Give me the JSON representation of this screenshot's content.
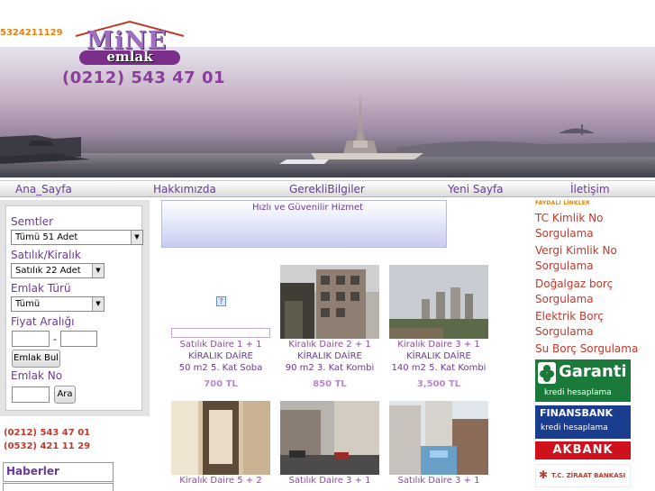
{
  "header": {
    "top_phone": "5324211129",
    "logo_line1": "MiNE",
    "logo_line2": "emlak",
    "phone": "(0212) 543 47 01"
  },
  "nav": [
    "Ana_Sayfa",
    "Hakkımızda",
    "GerekliBilgiler",
    "Yeni Sayfa",
    "İletişim"
  ],
  "search": {
    "semtler_label": "Semtler",
    "semtler_value": "Tümü    51   Adet",
    "satilik_label": "Satılık/Kiralık",
    "satilik_value": "Satılık    22  Adet",
    "emlak_turu_label": "Emlak Türü",
    "emlak_turu_value": "Tümü",
    "fiyat_label": "Fiyat Aralığı",
    "fiyat_dash": "-",
    "emlak_bul": "Emlak Bul",
    "emlak_no_label": "Emlak No",
    "ara": "Ara"
  },
  "contacts": [
    "(0212) 543 47 01",
    "(0532) 421 11 29"
  ],
  "haberler": "Haberler",
  "slogan": "Hızlı ve Güvenilir Hizmet",
  "listings": [
    {
      "line1": "Satılık  Daire 1 + 1",
      "line2": "KİRALIK DAİRE",
      "line3": "50 m2 5. Kat Soba",
      "price": "700 TL"
    },
    {
      "line1": "Kiralık  Daire 2 + 1",
      "line2": "KİRALIK DAİRE",
      "line3": "90 m2 3. Kat Kombi",
      "price": "850 TL"
    },
    {
      "line1": "Kiralık  Daire 3 + 1",
      "line2": "KİRALIK DAİRE",
      "line3": "140 m2 5. Kat Kombi",
      "price": "3,500 TL"
    },
    {
      "line1": "Kiralık  Daire 5 + 2",
      "line2": "",
      "line3": "",
      "price": ""
    },
    {
      "line1": "Satılık  Daire 3 + 1",
      "line2": "",
      "line3": "",
      "price": ""
    },
    {
      "line1": "Satılık  Daire 3 + 1",
      "line2": "",
      "line3": "",
      "price": ""
    }
  ],
  "links": {
    "title": "FAYDALI LİNKLER",
    "items": [
      "TC Kimlik No Sorgulama",
      "Vergi Kimlik No Sorgulama",
      "Doğalgaz borç Sorgulama",
      "Elektrik Borç Sorgulama",
      "Su Borç Sorgulama"
    ]
  },
  "banks": {
    "garanti": "Garanti",
    "garanti_sub": "kredi hesaplama",
    "finans": "FINANSBANK",
    "finans_sub": "kredi hesaplama",
    "akbank": "AKBANK",
    "ziraat": "T.C. ZİRAAT BANKASI"
  },
  "colors": {
    "accent": "#6a3a9a",
    "phone": "#e8820c",
    "link": "#c0392b"
  }
}
